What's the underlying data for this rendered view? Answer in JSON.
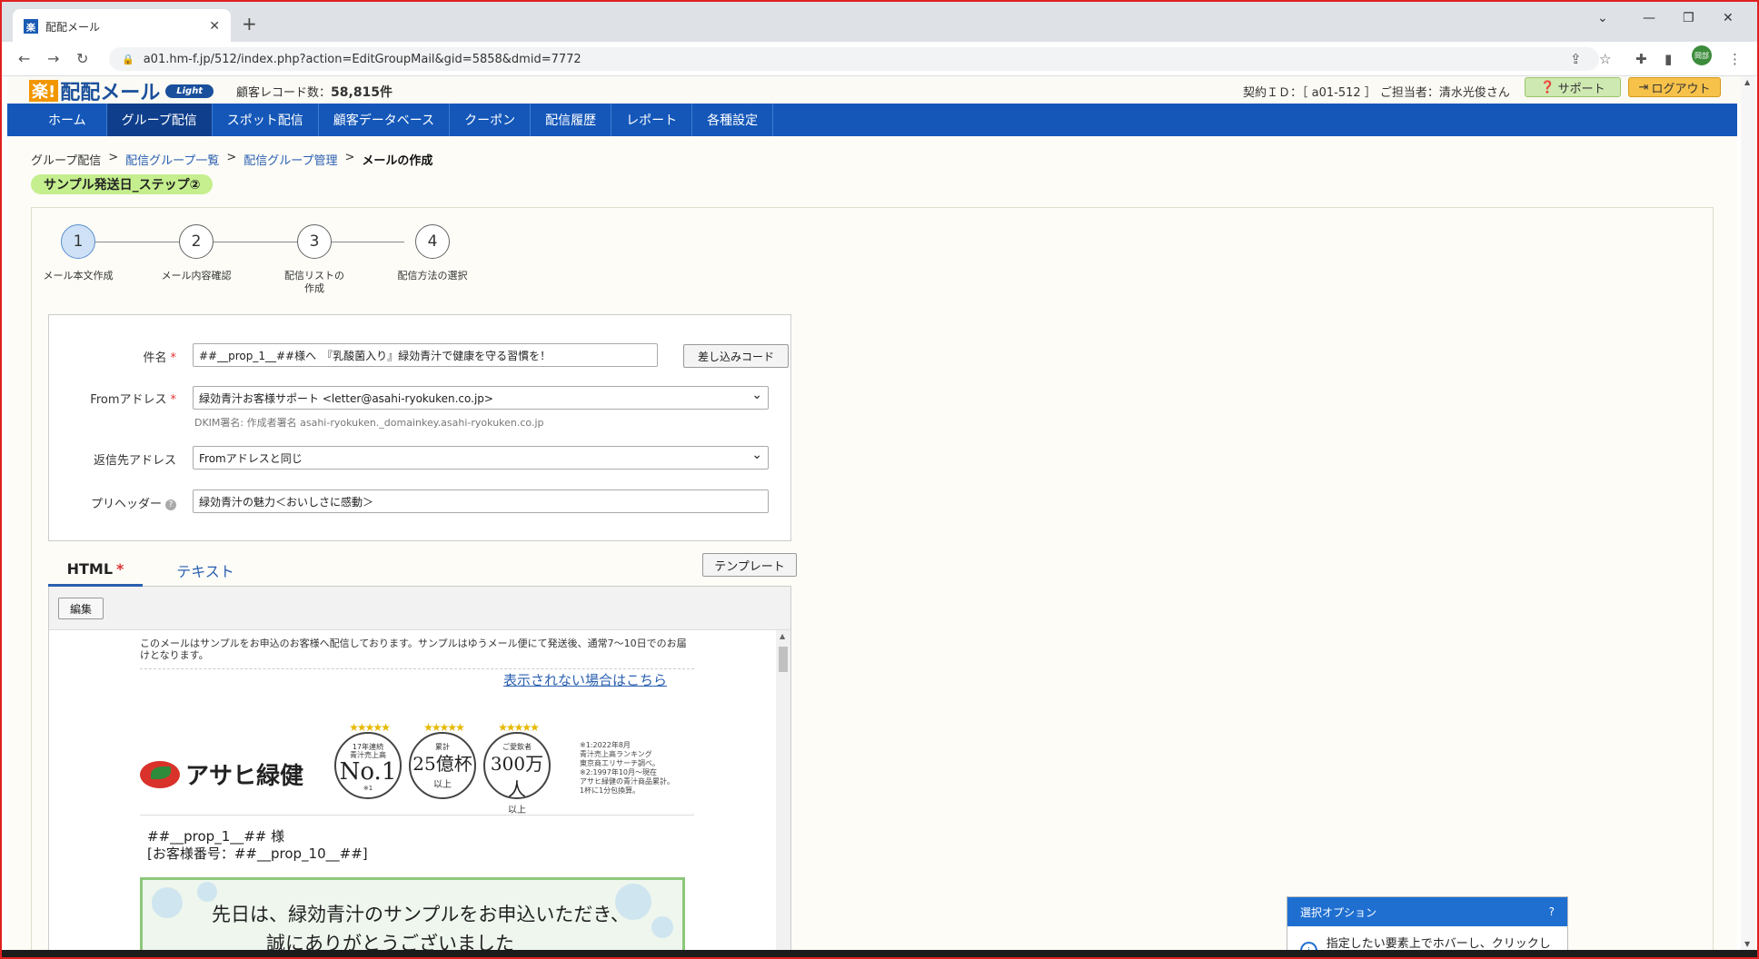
{
  "browser": {
    "tab_title": "配配メール",
    "tab_favicon": "楽",
    "url": "a01.hm-f.jp/512/index.php?action=EditGroupMail&gid=5858&dmid=7772",
    "profile_label": "岡部"
  },
  "header": {
    "logo_raku": "楽!",
    "logo_name": "配配メール",
    "logo_edition": "Light",
    "record_label": "顧客レコード数：",
    "record_count": "58,815件",
    "contract": "契約ＩＤ：［ a01-512 ］ ご担当者：清水光俊さん",
    "support_label": "サポート",
    "logout_label": "ログアウト"
  },
  "nav": {
    "items": [
      "ホーム",
      "グループ配信",
      "スポット配信",
      "顧客データベース",
      "クーポン",
      "配信履歴",
      "レポート",
      "各種設定"
    ]
  },
  "breadcrumb": {
    "root": "グループ配信",
    "sep": ">",
    "link1": "配信グループ一覧",
    "link2": "配信グループ管理",
    "current": "メールの作成"
  },
  "group_tag": "サンプル発送日_ステップ②",
  "steps": [
    {
      "num": "1",
      "label": "メール本文作成"
    },
    {
      "num": "2",
      "label": "メール内容確認"
    },
    {
      "num": "3",
      "label": "配信リストの\n作成"
    },
    {
      "num": "4",
      "label": "配信方法の選択"
    }
  ],
  "form": {
    "subject_label": "件名",
    "subject_value": "##__prop_1__##様へ　『乳酸菌入り』緑効青汁で健康を守る習慣を！",
    "insert_code_button": "差し込みコード",
    "from_label": "Fromアドレス",
    "from_value": "緑効青汁お客様サポート <letter@asahi-ryokuken.co.jp>",
    "dkim_note": "DKIM署名: 作成者署名 asahi-ryokuken._domainkey.asahi-ryokuken.co.jp",
    "reply_label": "返信先アドレス",
    "reply_value": "Fromアドレスと同じ",
    "preheader_label": "プリヘッダー",
    "preheader_value": "緑効青汁の魅力＜おいしさに感動＞",
    "required_mark": "*"
  },
  "editor": {
    "tab_html": "HTML",
    "tab_text": "テキスト",
    "template_button": "テンプレート",
    "edit_button": "編集"
  },
  "mail": {
    "notice": "このメールはサンプルをお申込のお客様へ配信しております。サンプルはゆうメール便にて発送後、通常7～10日でのお届けとなります。",
    "view_link": "表示されない場合はこちら",
    "brand": "アサヒ緑健",
    "badge1_small": "17年連続\n青汁売上高",
    "badge1_big": "No.1",
    "badge1_note": "※1",
    "badge2_small": "累計",
    "badge2_big": "25億杯",
    "badge2_unit": "以上",
    "badge3_small": "ご愛飲者",
    "badge3_big": "300万人",
    "badge3_unit": "以上",
    "notes": "※1:2022年8月\n青汁売上高ランキング\n東京商工リサーチ調べ。\n※2:1997年10月～現在\nアサヒ緑健の青汁商品累計。\n1杯に1分包換算。",
    "name_line1": "##__prop_1__## 様",
    "name_line2": "[お客様番号：##__prop_10__##]",
    "hero_line1": "先日は、緑効青汁のサンプルをお申込いただき、",
    "hero_line2": "誠にありがとうございました"
  },
  "popup": {
    "title": "選択オプション",
    "help": "?",
    "body": "指定したい要素上でホバーし、クリックして選"
  },
  "colors": {
    "nav_bg": "#1457b9",
    "nav_active": "#0f3f8c",
    "group_tag": "#c5ef8e",
    "support_btn": "#cfe9b2",
    "logout_btn": "#f6c24a",
    "link": "#2a5fb0"
  }
}
